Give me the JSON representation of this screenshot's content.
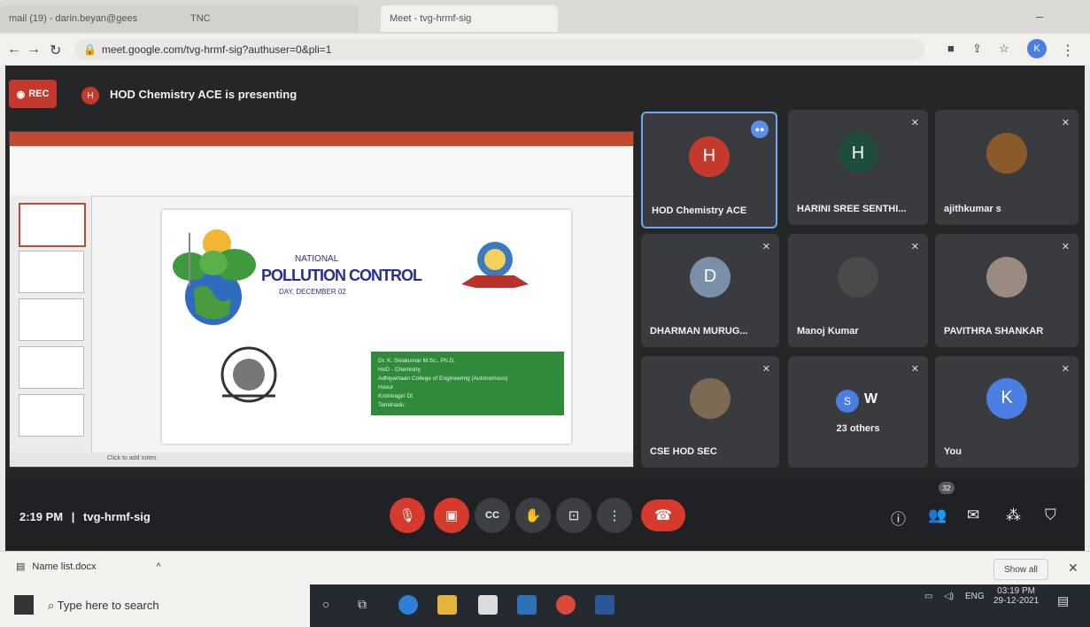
{
  "browser": {
    "tabs": [
      "mail (19) - darin.beyan@gees",
      "TNC",
      "Meet - tvg-hrmf-sig"
    ],
    "url": "meet.google.com/tvg-hrmf-sig?authuser=0&pli=1",
    "profile_initial": "K"
  },
  "meet": {
    "rec_label": "REC",
    "presenter_initial": "H",
    "presenting_text": "HOD Chemistry ACE is presenting",
    "time": "2:19 PM",
    "separator": "|",
    "meeting_code": "tvg-hrmf-sig",
    "people_count": "32",
    "participants": [
      {
        "name": "HOD Chemistry ACE",
        "initial": "H",
        "color": "#c5392d",
        "active": true
      },
      {
        "name": "HARINI SREE SENTHI...",
        "initial": "H",
        "color": "#1f4d3b",
        "active": false
      },
      {
        "name": "ajithkumar s",
        "initial": "",
        "color": "#8a5a2b",
        "active": false
      },
      {
        "name": "DHARMAN MURUG...",
        "initial": "D",
        "color": "#7a8fa8",
        "active": false
      },
      {
        "name": "Manoj Kumar",
        "initial": "",
        "color": "#444",
        "active": false
      },
      {
        "name": "PAVITHRA SHANKAR",
        "initial": "",
        "color": "#9b8a80",
        "active": false
      },
      {
        "name": "CSE HOD SEC",
        "initial": "",
        "color": "#7c6a55",
        "active": false
      },
      {
        "name": "23 others",
        "initial": "S",
        "color": "#4a7ee0",
        "active": false
      },
      {
        "name": "You",
        "initial": "K",
        "color": "#4a7ee0",
        "active": false
      }
    ]
  },
  "slide": {
    "national": "NATIONAL",
    "pollution_control": "POLLUTION CONTROL",
    "day": "DAY, DECEMBER 02",
    "green_lines": [
      "Dr. K. Sivakumar M.Sc., Ph.D.",
      "HoD - Chemistry",
      "Adhiyamaan College of Engineering (Autonomous)",
      "Hosur",
      "Krishnagiri Dt",
      "Tamilnadu"
    ],
    "status_note": "Click to add notes"
  },
  "downloads": {
    "file": "Name list.docx",
    "show_all": "Show all"
  },
  "taskbar": {
    "search_placeholder": "Type here to search",
    "lang": "ENG",
    "clock_time": "03:19 PM",
    "clock_date": "29-12-2021"
  }
}
